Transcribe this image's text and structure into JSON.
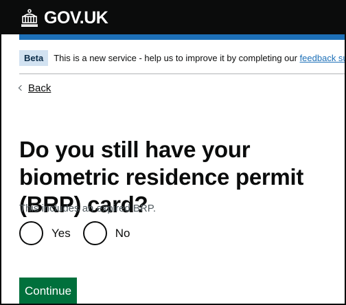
{
  "header": {
    "logo_text": "GOV.UK",
    "logo_icon": "crown-icon",
    "background": "#0b0c0c",
    "accent": "#1d70b8"
  },
  "phase_banner": {
    "tag": "Beta",
    "text": "This is a new service - help us to improve it by completing our ",
    "link_text": "feedback survey"
  },
  "back_link": {
    "label": "Back"
  },
  "question": {
    "heading": "Do you still have your biometric residence permit (BRP) card?",
    "hint": "This includes an expired BRP.",
    "options": [
      {
        "label": "Yes",
        "selected": false
      },
      {
        "label": "No",
        "selected": false
      }
    ]
  },
  "continue_button": {
    "label": "Continue",
    "color": "#00703c"
  }
}
